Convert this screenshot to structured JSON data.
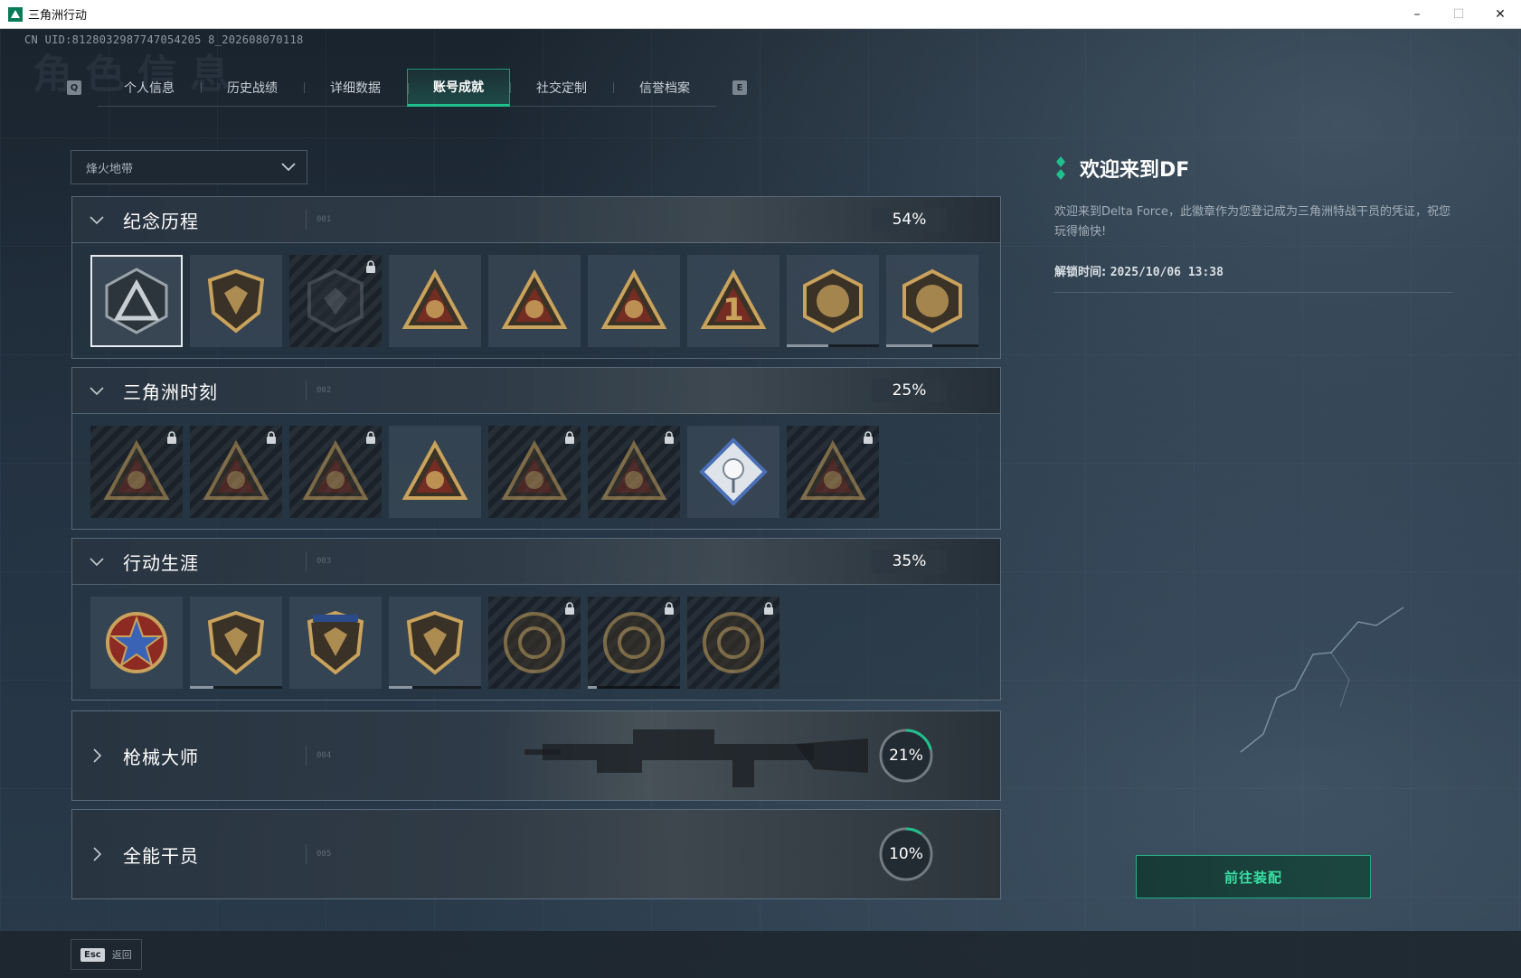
{
  "window": {
    "title": "三角洲行动",
    "minimize": "–",
    "maximize": "☐",
    "close": "✕"
  },
  "uid": "CN UID:8128032987747054205 8_202608070118",
  "ghost_title": "角色信息",
  "tabs": {
    "prev_key": "Q",
    "next_key": "E",
    "items": [
      {
        "label": "个人信息"
      },
      {
        "label": "历史战绩"
      },
      {
        "label": "详细数据"
      },
      {
        "label": "账号成就"
      },
      {
        "label": "社交定制"
      },
      {
        "label": "信誉档案"
      }
    ],
    "active_index": 3
  },
  "mode_dropdown": {
    "value": "烽火地带"
  },
  "sections": [
    {
      "title": "纪念历程",
      "code": "001",
      "progress_text": "54%",
      "expanded": true,
      "badges": [
        {
          "icon": "delta-triangle-emblem-icon",
          "locked": false,
          "selected": true
        },
        {
          "icon": "helicopter-emblem-icon",
          "locked": false
        },
        {
          "icon": "hex-shield-emblem-icon",
          "locked": true
        },
        {
          "icon": "tower-triangle-emblem-icon",
          "locked": false
        },
        {
          "icon": "s9-winged-emblem-icon",
          "locked": false
        },
        {
          "icon": "hand-triangle-emblem-icon",
          "locked": false
        },
        {
          "icon": "number-one-triangle-icon",
          "locked": false,
          "number": "1"
        },
        {
          "icon": "delta-force-round-emblem-icon",
          "locked": false,
          "progress": 0.45
        },
        {
          "icon": "delta-force-2025-emblem-icon",
          "locked": false,
          "progress": 0.5
        }
      ]
    },
    {
      "title": "三角洲时刻",
      "code": "002",
      "progress_text": "25%",
      "expanded": true,
      "badges": [
        {
          "icon": "robot-triangle-emblem-icon",
          "locked": true
        },
        {
          "icon": "runner-triangle-emblem-icon",
          "locked": true
        },
        {
          "icon": "heart-triangle-emblem-icon",
          "locked": true
        },
        {
          "icon": "soldiers-triangle-emblem-icon",
          "locked": false
        },
        {
          "icon": "beast-triangle-emblem-icon",
          "locked": true
        },
        {
          "icon": "fish-triangle-emblem-icon",
          "locked": true
        },
        {
          "icon": "rose-diamond-emblem-icon",
          "locked": false
        },
        {
          "icon": "mask-triangle-emblem-icon",
          "locked": true
        }
      ]
    },
    {
      "title": "行动生涯",
      "code": "003",
      "progress_text": "35%",
      "expanded": true,
      "badges": [
        {
          "icon": "star-medal-emblem-icon",
          "locked": false
        },
        {
          "icon": "chevron-shield-emblem-icon",
          "locked": false,
          "progress": 0.25
        },
        {
          "icon": "stars-shield-emblem-icon",
          "locked": false
        },
        {
          "icon": "gem-shield-emblem-icon",
          "locked": false,
          "progress": 0.25
        },
        {
          "icon": "round-relic-emblem-icon",
          "locked": true
        },
        {
          "icon": "skull-round-emblem-icon",
          "locked": true,
          "progress": 0.1
        },
        {
          "icon": "eye-round-emblem-icon",
          "locked": true
        }
      ]
    },
    {
      "title": "枪械大师",
      "code": "004",
      "progress_text": "21%",
      "progress": 0.21,
      "expanded": false
    },
    {
      "title": "全能干员",
      "code": "005",
      "progress_text": "10%",
      "progress": 0.1,
      "expanded": false
    }
  ],
  "info": {
    "title": "欢迎来到DF",
    "description": "欢迎来到Delta Force，此徽章作为您登记成为三角洲特战干员的凭证，祝您玩得愉快!",
    "unlock_label": "解锁时间: ",
    "unlock_time": "2025/10/06 13:38"
  },
  "equip_button": "前往装配",
  "footer": {
    "esc_key": "Esc",
    "back_label": "返回"
  },
  "colors": {
    "accent": "#1fc08c",
    "accent_text": "#38e0a4",
    "gold": "#c9a25c",
    "lock": "#cfd5da"
  }
}
